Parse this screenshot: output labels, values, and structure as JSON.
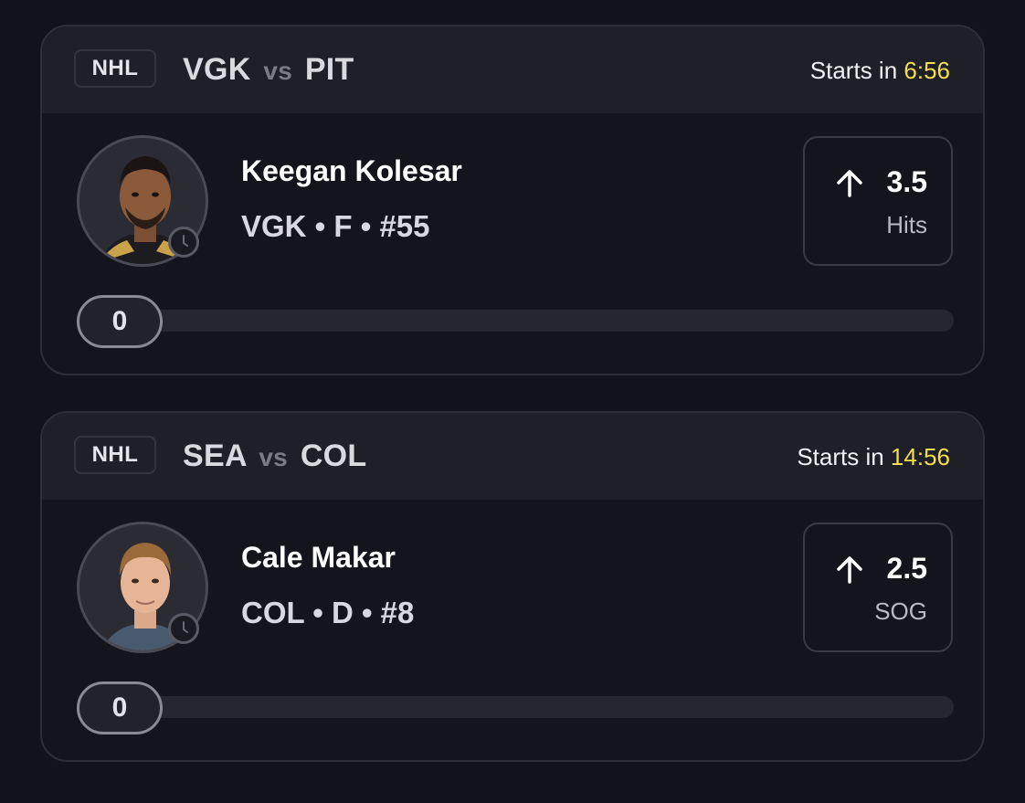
{
  "cards": [
    {
      "league": "NHL",
      "home": "VGK",
      "vs": "vs",
      "away": "PIT",
      "starts_label": "Starts in",
      "starts_time": "6:56",
      "player_name": "Keegan Kolesar",
      "player_meta": "VGK • F • #55",
      "direction": "up-arrow-icon",
      "line": "3.5",
      "stat": "Hits",
      "progress_value": "0",
      "progress_fraction": 0
    },
    {
      "league": "NHL",
      "home": "SEA",
      "vs": "vs",
      "away": "COL",
      "starts_label": "Starts in",
      "starts_time": "14:56",
      "player_name": "Cale Makar",
      "player_meta": "COL • D • #8",
      "direction": "up-arrow-icon",
      "line": "2.5",
      "stat": "SOG",
      "progress_value": "0",
      "progress_fraction": 0
    }
  ],
  "colors": {
    "background": "#12121a",
    "card": "#14141c",
    "header": "#1f1f28",
    "accent_time": "#f2df4a"
  }
}
